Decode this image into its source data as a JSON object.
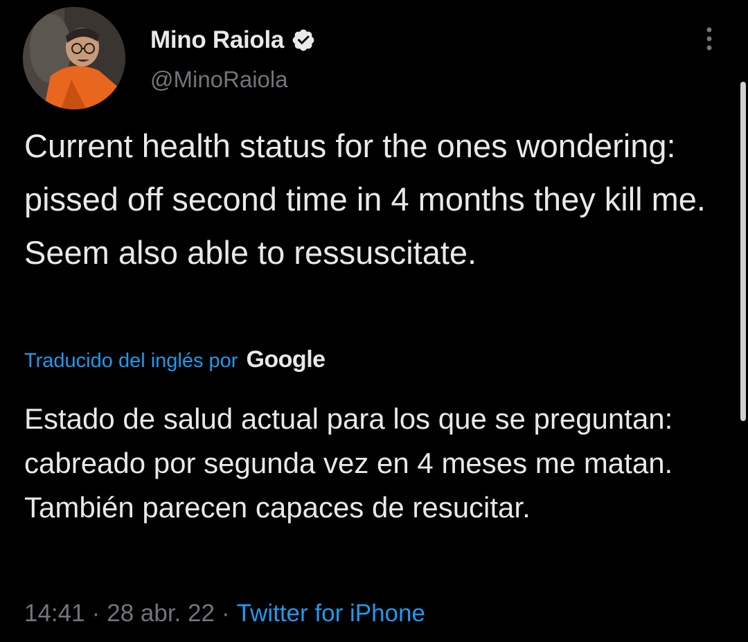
{
  "author": {
    "display_name": "Mino Raiola",
    "handle": "@MinoRaiola",
    "verified": true,
    "icons": {
      "verified": "verified-badge-icon",
      "more": "more-options-icon"
    }
  },
  "tweet": {
    "text": "Current health status for the ones wondering: pissed off second time in 4 months they kill me. Seem also able to ressuscitate.",
    "translation_label": "Traducido del inglés por",
    "translation_provider": "Google",
    "translated_text": "Estado de salud actual para los que se preguntan: cabreado por segunda vez en 4 meses me matan. También parecen capaces de resucitar.",
    "time": "14:41",
    "separator": "·",
    "date": "28 abr. 22",
    "source": "Twitter for iPhone"
  },
  "colors": {
    "background": "#000000",
    "text_primary": "#e7e9ea",
    "text_secondary": "#71767b",
    "accent": "#1d9bf0"
  }
}
